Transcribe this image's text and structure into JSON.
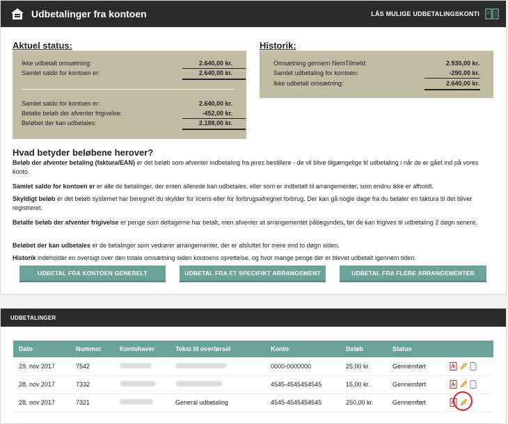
{
  "header": {
    "title": "Udbetalinger fra kontoen",
    "right_link": "LÅS MULIGE UDBETALINGSKONTI"
  },
  "status": {
    "heading": "Aktuel status:",
    "rows_a": [
      {
        "label": "Ikke udbetalt omsætning:",
        "value": "2.640,00 kr."
      },
      {
        "label": "Samlet saldo for kontoen er:",
        "value": "2.640,00 kr."
      }
    ],
    "rows_b": [
      {
        "label": "Samlet saldo for kontoen er:",
        "value": "2.640,00 kr."
      },
      {
        "label": "Betalte beløb der afventer frigivelse:",
        "value": "-452,00 kr."
      },
      {
        "label": "Beløbet der kan udbetales:",
        "value": "2.188,00 kr."
      }
    ]
  },
  "history": {
    "heading": "Historik:",
    "rows": [
      {
        "label": "Omsætning gennem NemTilmeld:",
        "value": "2.930,00 kr."
      },
      {
        "label": "Samlet udbetaling for kontoen:",
        "value": "-290,00 kr."
      },
      {
        "label": "Ikke udbetalt omsætning:",
        "value": "2.640,00 kr."
      }
    ]
  },
  "explanation": {
    "heading": "Hvad betyder beløbene herover?",
    "items": [
      {
        "term": "Beløb der afventer betaling (faktura/EAN)",
        "text": " er det beløb som afventer indbetaling fra jeres bestillere - de vil blive tilgængelige til udbetaling i når de er gået ind på vores konto."
      },
      {
        "term": "Samlet saldo for kontoen er",
        "text": " er alle de betalinger, der enten allerede kan udbetales, eller som er indbetalt til arrangementer, som endnu ikke er afholdt."
      },
      {
        "term": "Skyldigt beløb",
        "text": " er det beløb systemet har beregnet du skylder for licens eller for forbrugsafregnet forbrug. Der kan gå nogle dage fra du betaler en faktura til det bliver registreret."
      },
      {
        "term": "Betalte beløb der afventer frigivelse",
        "text": " er penge som deltagerne har betalt, men afventer at arrangementet påbegyndes, før de kan frigives til udbetaling 2 døgn senere."
      },
      {
        "term": "Beløbet der kan udbetales",
        "text": " er de betalinger som vedrører arrangementer, der er afsluttet for mere end to døgn siden."
      },
      {
        "term": "Historik",
        "text": " indeholder en oversigt over den totale omsætning siden kontoens oprettelse, og hvor mange penge der er blevet udbetalt igennem tiden."
      }
    ]
  },
  "buttons": {
    "general": "UDBETAL FRA KONTOEN GENERELT",
    "specific": "UDBETAL FRA ET SPECIFIKT ARRANGEMENT",
    "multiple": "UDBETAL FRA FLERE ARRANGEMENTER"
  },
  "payouts": {
    "heading": "UDBETALINGER",
    "columns": [
      "Dato",
      "Nummer",
      "Kontohaver",
      "Tekst til overførsel",
      "Konto",
      "Beløb",
      "Status"
    ],
    "rows": [
      {
        "date": "29. nov 2017",
        "number": "7542",
        "text": "",
        "account": "0000-0000000",
        "amount": "25,00 kr.",
        "status": "Gennemført"
      },
      {
        "date": "28. nov 2017",
        "number": "7332",
        "text": "",
        "account": "4545-4545454545",
        "amount": "15,00 kr.",
        "status": "Gennemført"
      },
      {
        "date": "28. nov 2017",
        "number": "7321",
        "text": "General udbetaling",
        "account": "4545-4545454545",
        "amount": "250,00 kr.",
        "status": "Gennemført"
      }
    ]
  },
  "colors": {
    "dark_header": "#2b2b2b",
    "box_bg": "#c1bca4",
    "teal": "#6ba29a",
    "highlight": "#e02020"
  }
}
